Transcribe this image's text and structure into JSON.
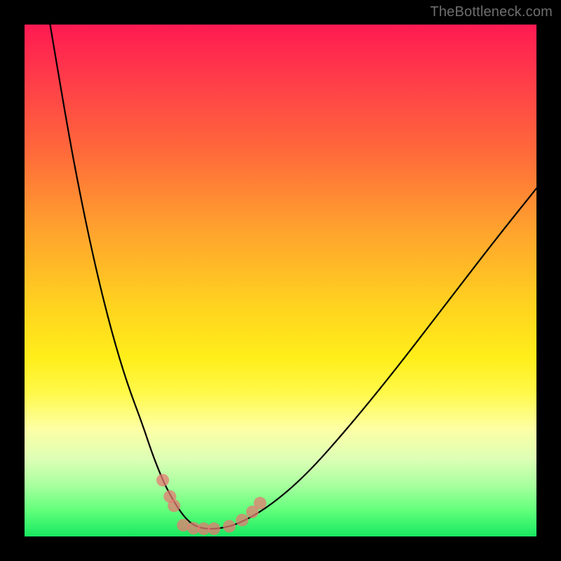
{
  "watermark": "TheBottleneck.com",
  "chart_data": {
    "type": "line",
    "title": "",
    "xlabel": "",
    "ylabel": "",
    "xlim": [
      0,
      100
    ],
    "ylim": [
      0,
      100
    ],
    "series": [
      {
        "name": "curve",
        "x": [
          5,
          8,
          11,
          14,
          17,
          20,
          23,
          25,
          27,
          28.5,
          30,
          31.5,
          33,
          35,
          38,
          42,
          48,
          55,
          63,
          72,
          82,
          92,
          100
        ],
        "y": [
          100,
          82,
          66,
          52,
          40,
          30,
          22,
          16,
          11,
          8,
          5.5,
          3.5,
          2.2,
          1.5,
          1.5,
          2.5,
          6,
          12,
          21,
          32,
          45,
          58,
          68
        ]
      }
    ],
    "markers": [
      {
        "x": 27.0,
        "y": 11.0
      },
      {
        "x": 28.4,
        "y": 7.8
      },
      {
        "x": 29.2,
        "y": 6.0
      },
      {
        "x": 31.0,
        "y": 2.2
      },
      {
        "x": 33.0,
        "y": 1.6
      },
      {
        "x": 35.0,
        "y": 1.5
      },
      {
        "x": 37.0,
        "y": 1.5
      },
      {
        "x": 40.0,
        "y": 2.0
      },
      {
        "x": 42.5,
        "y": 3.2
      },
      {
        "x": 44.5,
        "y": 4.8
      },
      {
        "x": 46.0,
        "y": 6.5
      }
    ],
    "gradient_stops": [
      {
        "pos": 0,
        "color": "#ff1a52"
      },
      {
        "pos": 25,
        "color": "#ff6a3a"
      },
      {
        "pos": 55,
        "color": "#ffd31f"
      },
      {
        "pos": 79,
        "color": "#fdffa5"
      },
      {
        "pos": 95,
        "color": "#60ff7a"
      },
      {
        "pos": 100,
        "color": "#18e860"
      }
    ]
  }
}
